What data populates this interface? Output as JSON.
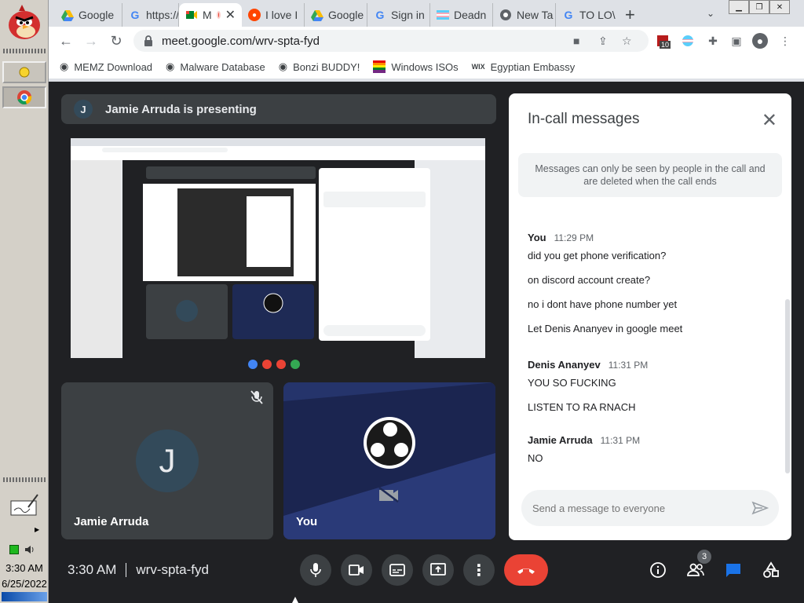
{
  "taskbar": {
    "time": "3:30 AM",
    "date": "6/25/2022"
  },
  "tabs": [
    {
      "label": "Google",
      "icon": "google-drive-icon"
    },
    {
      "label": "https://",
      "icon": "google-g-icon"
    },
    {
      "label": "M",
      "icon": "meet-icon",
      "active": true,
      "recording": true
    },
    {
      "label": "I love I",
      "icon": "reddit-icon"
    },
    {
      "label": "Google",
      "icon": "google-drive-icon"
    },
    {
      "label": "Sign in",
      "icon": "google-g-icon"
    },
    {
      "label": "Deadn",
      "icon": "trans-flag-icon"
    },
    {
      "label": "New Ta",
      "icon": "chrome-icon"
    },
    {
      "label": "TO LO\\",
      "icon": "google-g-icon"
    }
  ],
  "address": {
    "url": "meet.google.com/wrv-spta-fyd"
  },
  "extensions": {
    "badge_count": "10"
  },
  "bookmarks": [
    {
      "label": "MEMZ Download",
      "icon": "globe-icon"
    },
    {
      "label": "Malware Database",
      "icon": "globe-icon"
    },
    {
      "label": "Bonzi BUDDY!",
      "icon": "globe-icon"
    },
    {
      "label": "Windows ISOs",
      "icon": "rainbow-flag-icon"
    },
    {
      "label": "Egyptian Embassy",
      "icon": "wix-icon"
    }
  ],
  "meet": {
    "presenter_initial": "J",
    "presenting_text": "Jamie Arruda is presenting",
    "tiles": [
      {
        "name": "Jamie Arruda",
        "initial": "J",
        "muted": true
      },
      {
        "name": "You",
        "camera_off": true
      }
    ],
    "clock": "3:30 AM",
    "meeting_code": "wrv-spta-fyd",
    "people_count": "3"
  },
  "panel": {
    "title": "In-call messages",
    "info": "Messages can only be seen by people in the call and are deleted when the call ends",
    "messages": [
      {
        "sender": "You",
        "time": "11:29 PM",
        "lines": [
          "did you get phone verification?",
          "on discord account create?",
          "no i dont have  phone number yet",
          "Let Denis Ananyev in google meet"
        ]
      },
      {
        "sender": "Denis Ananyev",
        "time": "11:31 PM",
        "lines": [
          "YOU SO FUCKING",
          "LISTEN TO RA RNACH"
        ]
      },
      {
        "sender": "Jamie Arruda",
        "time": "11:31 PM",
        "lines": [
          "NO"
        ]
      }
    ],
    "input_placeholder": "Send a message to everyone"
  },
  "colors": {
    "accent": "#1a73e8",
    "end_call": "#ea4335",
    "meet_bg": "#202124",
    "tile_bg": "#3c4043"
  }
}
